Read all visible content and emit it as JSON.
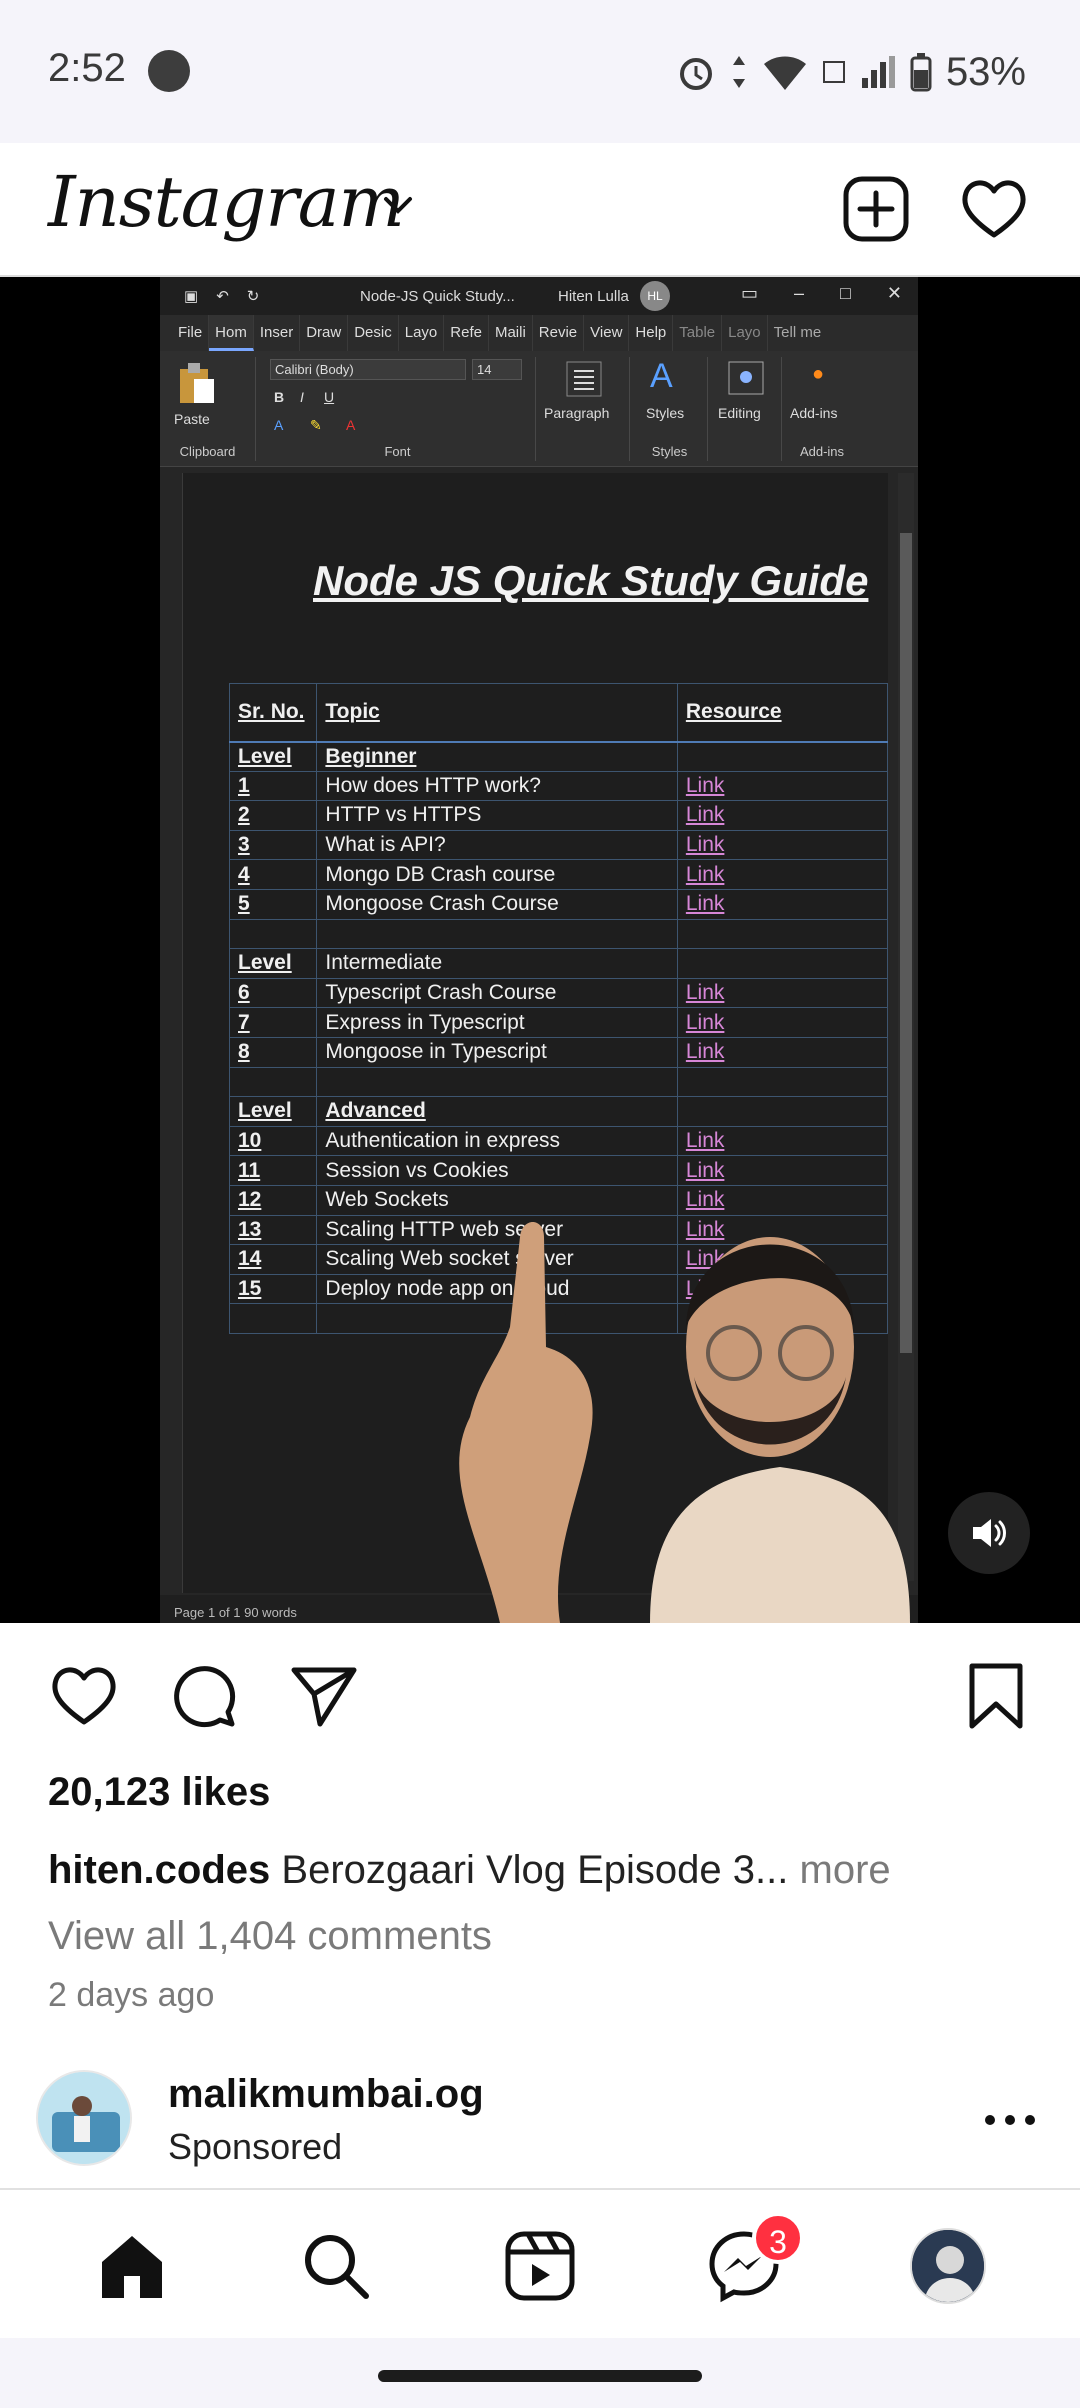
{
  "status_bar": {
    "time": "2:52",
    "battery": "53%"
  },
  "top_bar": {
    "logo": "Instagram"
  },
  "media": {
    "window": {
      "doc_name": "Node-JS Quick Study...",
      "user_name": "Hiten Lulla",
      "user_initials": "HL",
      "tabs": [
        "File",
        "Hom",
        "Inser",
        "Draw",
        "Desic",
        "Layo",
        "Refe",
        "Maili",
        "Revie",
        "View",
        "Help",
        "Table",
        "Layo",
        "Tell me"
      ],
      "ribbon": {
        "paste": "Paste",
        "clipboard": "Clipboard",
        "font_name": "Calibri (Body)",
        "font_size": "14",
        "font": "Font",
        "paragraph": "Paragraph",
        "styles_btn": "Styles",
        "styles_group": "Styles",
        "editing": "Editing",
        "addins_btn": "Add-ins",
        "addins_group": "Add-ins"
      },
      "status_line": "Page 1 of 1     90 words"
    },
    "document": {
      "title": "Node JS Quick Study Guide",
      "headers": [
        "Sr. No.",
        "Topic",
        "Resource"
      ],
      "rows": [
        {
          "no": "Level",
          "topic": "Beginner",
          "res": ""
        },
        {
          "no": "1",
          "topic": "How does HTTP work?",
          "res": "Link"
        },
        {
          "no": "2",
          "topic": "HTTP vs HTTPS",
          "res": "Link"
        },
        {
          "no": "3",
          "topic": "What is API?",
          "res": "Link"
        },
        {
          "no": "4",
          "topic": "Mongo DB Crash course",
          "res": "Link"
        },
        {
          "no": "5",
          "topic": "Mongoose Crash Course",
          "res": "Link"
        },
        {
          "no": "",
          "topic": "",
          "res": ""
        },
        {
          "no": "Level",
          "topic": "Intermediate",
          "res": ""
        },
        {
          "no": "6",
          "topic": "Typescript Crash Course",
          "res": "Link"
        },
        {
          "no": "7",
          "topic": "Express in Typescript",
          "res": "Link"
        },
        {
          "no": "8",
          "topic": "Mongoose in Typescript",
          "res": "Link"
        },
        {
          "no": "",
          "topic": "",
          "res": ""
        },
        {
          "no": "Level",
          "topic": "Advanced",
          "res": ""
        },
        {
          "no": "10",
          "topic": "Authentication in express",
          "res": "Link"
        },
        {
          "no": "11",
          "topic": "Session vs Cookies",
          "res": "Link"
        },
        {
          "no": "12",
          "topic": "Web Sockets",
          "res": "Link"
        },
        {
          "no": "13",
          "topic": "Scaling HTTP web server",
          "res": "Link"
        },
        {
          "no": "14",
          "topic": "Scaling Web socket server",
          "res": "Link"
        },
        {
          "no": "15",
          "topic": "Deploy node app on cloud",
          "res": "Link"
        },
        {
          "no": "",
          "topic": "",
          "res": ""
        }
      ]
    }
  },
  "post": {
    "likes": "20,123 likes",
    "username": "hiten.codes",
    "caption": "Berozgaari Vlog Episode 3...",
    "more": "more",
    "comments": "View all 1,404 comments",
    "age": "2 days ago"
  },
  "next_post": {
    "username": "malikmumbai.og",
    "sponsored": "Sponsored"
  },
  "bottom_nav": {
    "messages_badge": "3"
  },
  "colors": {
    "link": "#d787d7",
    "badge": "#ff3040"
  }
}
